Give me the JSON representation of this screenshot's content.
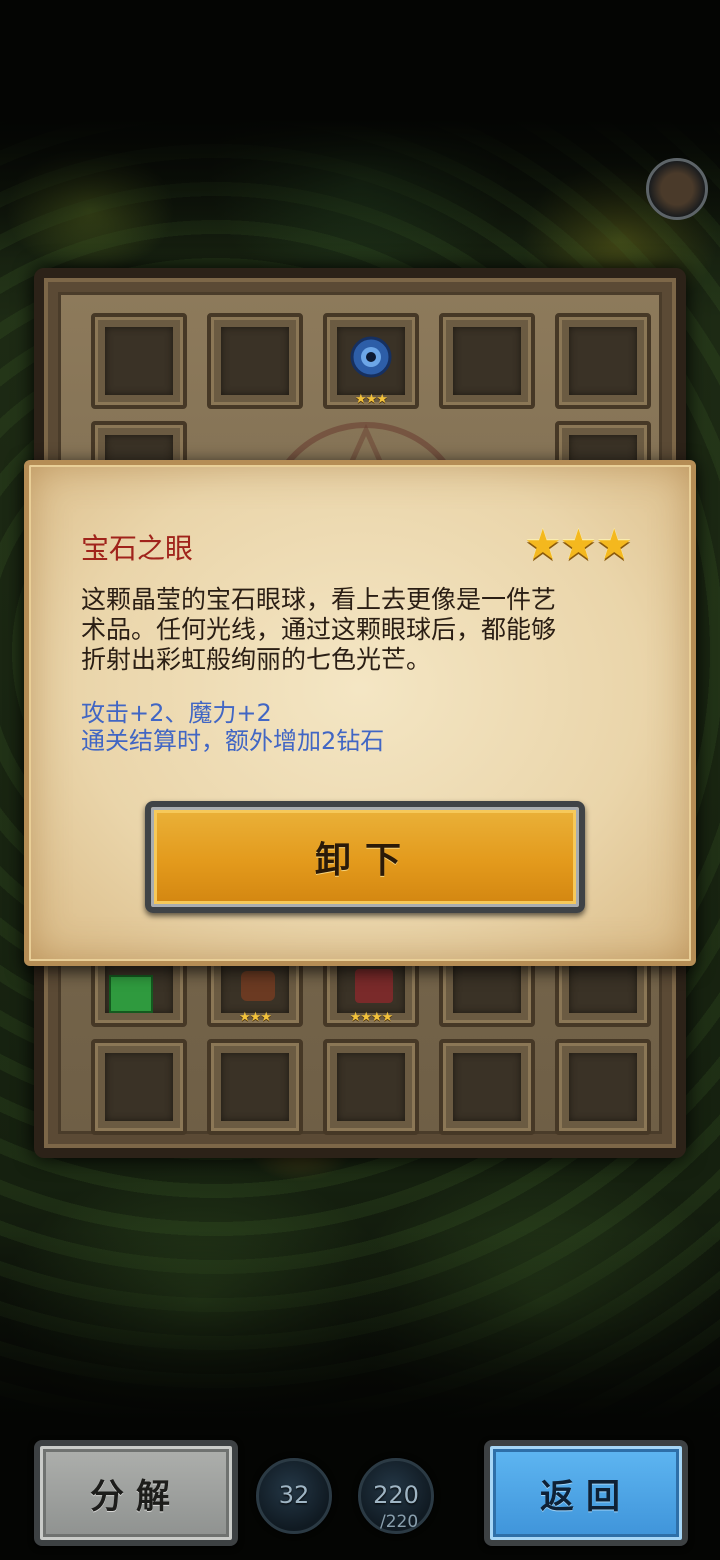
{
  "item": {
    "name": "宝石之眼",
    "stars": "★★★",
    "description_lines": [
      "这颗晶莹的宝石眼球，看上去更像是一件艺",
      "术品。任何光线，通过这颗眼球后，都能够",
      "折射出彩虹般绚丽的七色光芒。"
    ],
    "stats_lines": [
      "攻击+2、魔力+2",
      "通关结算时，额外增加2钻石"
    ],
    "unequip_label": "卸下"
  },
  "inventory": {
    "row1_stars": {
      "gem_eye": "★★★"
    },
    "row3_stars": {
      "slot2": "★★★",
      "slot3": "★★★★"
    }
  },
  "bottom": {
    "decompose_label": "分解",
    "return_label": "返回",
    "resource_a": "32",
    "resource_b": "220",
    "resource_b_cap": "/220"
  }
}
